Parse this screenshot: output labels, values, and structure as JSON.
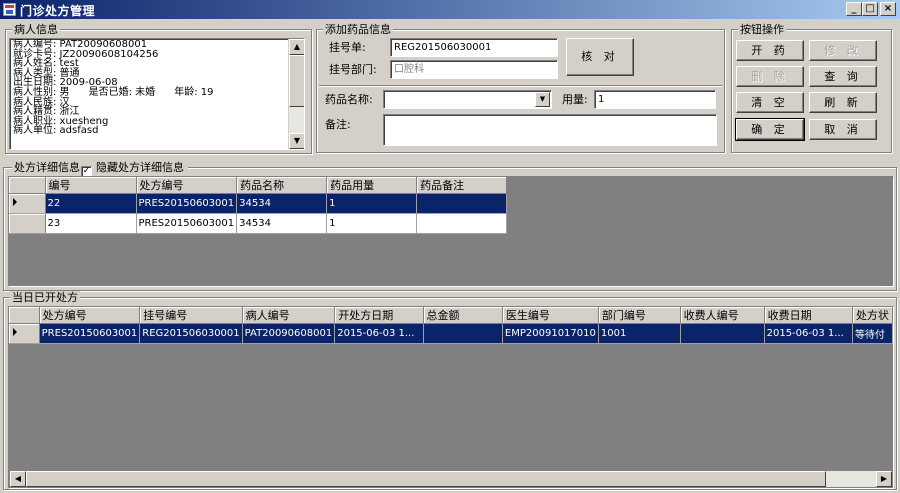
{
  "window": {
    "title": "门诊处方管理",
    "min_glyph": "_",
    "max_glyph": "□",
    "close_glyph": "×"
  },
  "patient_info": {
    "title": "病人信息",
    "lines": [
      "病人编号: PAT20090608001",
      "就诊卡号: JZ20090608104256",
      "病人姓名: test",
      "病人类型: 普通",
      "出生日期: 2009-06-08",
      "病人性别: 男      是否已婚: 未婚      年龄: 19",
      "病人民族: 汉",
      "病人籍贯: 浙江",
      "病人职业: xuesheng",
      "病人单位: adsfasd"
    ]
  },
  "add_drug": {
    "title": "添加药品信息",
    "reg_label": "挂号单:",
    "reg_value": "REG201506030001",
    "dept_label": "挂号部门:",
    "dept_value": "口腔科",
    "verify_button": "核 对",
    "drug_name_label": "药品名称:",
    "drug_name_value": "",
    "dosage_label": "用量:",
    "dosage_value": "1",
    "note_label": "备注:",
    "note_value": ""
  },
  "actions": {
    "title": "按钮操作",
    "prescribe": "开 药",
    "modify": "修 改",
    "delete": "删 除",
    "query": "查 询",
    "clear": "清 空",
    "refresh": "刷 新",
    "confirm": "确 定",
    "cancel": "取 消"
  },
  "detail_section": {
    "title": "处方详细信息",
    "checkbox_checked": true,
    "checkbox_glyph": "✓",
    "hide_label": "隐藏处方详细信息",
    "columns": [
      "编号",
      "处方编号",
      "药品名称",
      "药品用量",
      "药品备注"
    ],
    "rows": [
      [
        "22",
        "PRES20150603001",
        "34534",
        "1",
        ""
      ],
      [
        "23",
        "PRES20150603001",
        "34534",
        "1",
        ""
      ]
    ],
    "selected_row": 0
  },
  "today_section": {
    "title": "当日已开处方",
    "columns": [
      "处方编号",
      "挂号编号",
      "病人编号",
      "开处方日期",
      "总金额",
      "医生编号",
      "部门编号",
      "收费人编号",
      "收费日期",
      "处方状"
    ],
    "rows": [
      [
        "PRES20150603001",
        "REG201506030001",
        "PAT20090608001",
        "2015-06-03 1...",
        "",
        "EMP20091017010",
        "1001",
        "",
        "2015-06-03 1...",
        "等待付"
      ]
    ],
    "selected_row": 0
  },
  "icons": {
    "scroll_up": "▲",
    "scroll_down": "▼",
    "scroll_left": "◀",
    "scroll_right": "▶",
    "combo_down": "▼"
  }
}
